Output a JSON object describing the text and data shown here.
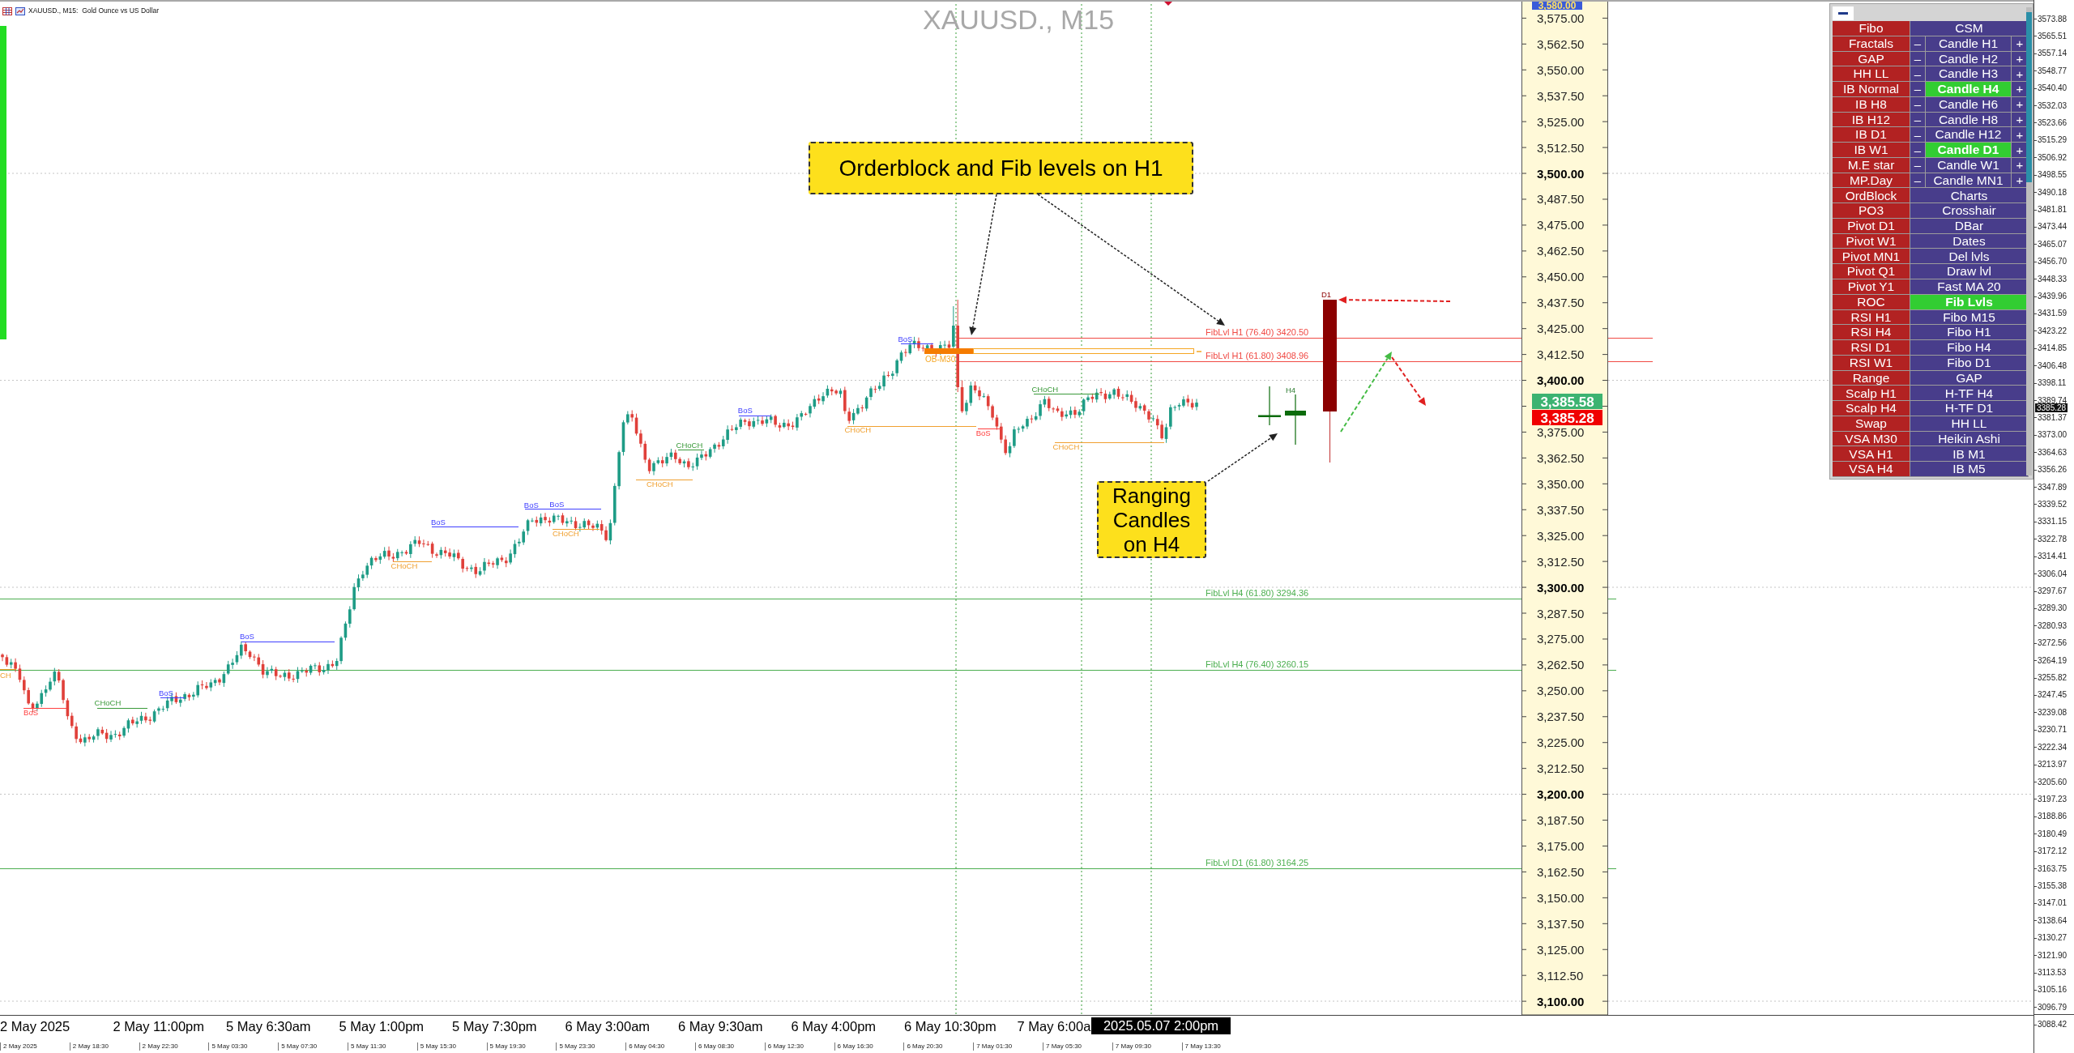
{
  "header": {
    "title": "XAUUSD., M15:  Gold Ounce vs US Dollar"
  },
  "chart": {
    "symbol_label": "XAUUSD., M15",
    "callouts": [
      {
        "text": "Orderblock and Fib levels on H1"
      },
      {
        "text": "Ranging Candles on H4"
      }
    ],
    "orderblock": {
      "label": "OB-M30"
    },
    "fib_levels": [
      {
        "label": "FibLvl H1 (76.40) 3420.50",
        "color": "#f04a44"
      },
      {
        "label": "FibLvl H1 (61.80) 3408.96",
        "color": "#f04a44"
      },
      {
        "label": "FibLvl H4 (61.80) 3294.36",
        "color": "#4caf50"
      },
      {
        "label": "FibLvl H4 (76.40) 3260.15",
        "color": "#4caf50"
      },
      {
        "label": "FibLvl D1 (61.80) 3164.25",
        "color": "#4caf50"
      }
    ],
    "structure_marks": [
      {
        "label": "CH",
        "color": "#f0a030"
      },
      {
        "label": "BoS",
        "color": "#ff4040"
      },
      {
        "label": "CHoCH",
        "color": "#3a9a3a"
      },
      {
        "label": "BoS",
        "color": "#4040ff"
      },
      {
        "label": "BoS",
        "color": "#4040ff"
      },
      {
        "label": "CHoCH",
        "color": "#f0a030"
      },
      {
        "label": "BoS",
        "color": "#4040ff"
      },
      {
        "label": "BoS",
        "color": "#4040ff"
      },
      {
        "label": "BoS",
        "color": "#4040ff"
      },
      {
        "label": "CHoCH",
        "color": "#f0a030"
      },
      {
        "label": "CHoCH",
        "color": "#f0a030"
      },
      {
        "label": "CHoCH",
        "color": "#3a9a3a"
      },
      {
        "label": "BoS",
        "color": "#4040ff"
      },
      {
        "label": "CHoCH",
        "color": "#f0a030"
      },
      {
        "label": "BoS",
        "color": "#4040ff"
      },
      {
        "label": "BoS",
        "color": "#ff4040"
      },
      {
        "label": "CHoCH",
        "color": "#3a9a3a"
      },
      {
        "label": "CHoCH",
        "color": "#f0a030"
      }
    ],
    "higher_timeframe": {
      "h4_label": "H4",
      "d1_label": "D1"
    }
  },
  "price_scale": {
    "labels": [
      {
        "text": "3,575.00",
        "major": false
      },
      {
        "text": "3,562.50",
        "major": false
      },
      {
        "text": "3,550.00",
        "major": false
      },
      {
        "text": "3,537.50",
        "major": false
      },
      {
        "text": "3,525.00",
        "major": false
      },
      {
        "text": "3,512.50",
        "major": false
      },
      {
        "text": "3,500.00",
        "major": true
      },
      {
        "text": "3,487.50",
        "major": false
      },
      {
        "text": "3,475.00",
        "major": false
      },
      {
        "text": "3,462.50",
        "major": false
      },
      {
        "text": "3,450.00",
        "major": false
      },
      {
        "text": "3,437.50",
        "major": false
      },
      {
        "text": "3,425.00",
        "major": false
      },
      {
        "text": "3,412.50",
        "major": false
      },
      {
        "text": "3,400.00",
        "major": true
      },
      {
        "text": "3,375.00",
        "major": false
      },
      {
        "text": "3,362.50",
        "major": false
      },
      {
        "text": "3,350.00",
        "major": false
      },
      {
        "text": "3,337.50",
        "major": false
      },
      {
        "text": "3,325.00",
        "major": false
      },
      {
        "text": "3,312.50",
        "major": false
      },
      {
        "text": "3,300.00",
        "major": true
      },
      {
        "text": "3,287.50",
        "major": false
      },
      {
        "text": "3,275.00",
        "major": false
      },
      {
        "text": "3,262.50",
        "major": false
      },
      {
        "text": "3,250.00",
        "major": false
      },
      {
        "text": "3,237.50",
        "major": false
      },
      {
        "text": "3,225.00",
        "major": false
      },
      {
        "text": "3,212.50",
        "major": false
      },
      {
        "text": "3,200.00",
        "major": true
      },
      {
        "text": "3,187.50",
        "major": false
      },
      {
        "text": "3,175.00",
        "major": false
      },
      {
        "text": "3,162.50",
        "major": false
      },
      {
        "text": "3,150.00",
        "major": false
      },
      {
        "text": "3,137.50",
        "major": false
      },
      {
        "text": "3,125.00",
        "major": false
      },
      {
        "text": "3,112.50",
        "major": false
      },
      {
        "text": "3,100.00",
        "major": true
      }
    ],
    "tags": [
      {
        "kind": "high",
        "text": "3,580.00"
      },
      {
        "kind": "ask",
        "text": "3,385.58"
      },
      {
        "kind": "bid",
        "text": "3,385.28"
      }
    ]
  },
  "panel": {
    "rows": [
      {
        "left": {
          "label": "Fibo",
          "selected": false
        },
        "right": {
          "label": "CSM",
          "selected": false
        }
      },
      {
        "left": {
          "label": "Fractals",
          "selected": false
        },
        "right": {
          "label": "Candle H1",
          "selected": false,
          "minus": "–",
          "plus": "+"
        }
      },
      {
        "left": {
          "label": "GAP",
          "selected": false
        },
        "right": {
          "label": "Candle H2",
          "selected": false,
          "minus": "–",
          "plus": "+"
        }
      },
      {
        "left": {
          "label": "HH LL",
          "selected": false
        },
        "right": {
          "label": "Candle H3",
          "selected": false,
          "minus": "–",
          "plus": "+"
        }
      },
      {
        "left": {
          "label": "IB Normal",
          "selected": false
        },
        "right": {
          "label": "Candle H4",
          "selected": true,
          "minus": "–",
          "plus": "+"
        }
      },
      {
        "left": {
          "label": "IB H8",
          "selected": false
        },
        "right": {
          "label": "Candle H6",
          "selected": false,
          "minus": "–",
          "plus": "+"
        }
      },
      {
        "left": {
          "label": "IB H12",
          "selected": false
        },
        "right": {
          "label": "Candle H8",
          "selected": false,
          "minus": "–",
          "plus": "+"
        }
      },
      {
        "left": {
          "label": "IB D1",
          "selected": false
        },
        "right": {
          "label": "Candle H12",
          "selected": false,
          "minus": "–",
          "plus": "+"
        }
      },
      {
        "left": {
          "label": "IB W1",
          "selected": false
        },
        "right": {
          "label": "Candle D1",
          "selected": true,
          "minus": "–",
          "plus": "+"
        }
      },
      {
        "left": {
          "label": "M.E star",
          "selected": false
        },
        "right": {
          "label": "Candle W1",
          "selected": false,
          "minus": "–",
          "plus": "+"
        }
      },
      {
        "left": {
          "label": "MP.Day",
          "selected": false
        },
        "right": {
          "label": "Candle MN1",
          "selected": false,
          "minus": "–",
          "plus": "+"
        }
      },
      {
        "left": {
          "label": "OrdBlock",
          "selected": false
        },
        "right": {
          "label": "Charts",
          "selected": false
        }
      },
      {
        "left": {
          "label": "PO3",
          "selected": false
        },
        "right": {
          "label": "Crosshair",
          "selected": false
        }
      },
      {
        "left": {
          "label": "Pivot D1",
          "selected": false
        },
        "right": {
          "label": "DBar",
          "selected": false
        }
      },
      {
        "left": {
          "label": "Pivot W1",
          "selected": false
        },
        "right": {
          "label": "Dates",
          "selected": false
        }
      },
      {
        "left": {
          "label": "Pivot MN1",
          "selected": false
        },
        "right": {
          "label": "Del lvls",
          "selected": false
        }
      },
      {
        "left": {
          "label": "Pivot Q1",
          "selected": false
        },
        "right": {
          "label": "Draw lvl",
          "selected": false
        }
      },
      {
        "left": {
          "label": "Pivot Y1",
          "selected": false
        },
        "right": {
          "label": "Fast MA 20",
          "selected": false
        }
      },
      {
        "left": {
          "label": "ROC",
          "selected": false
        },
        "right": {
          "label": "Fib Lvls",
          "selected": true
        }
      },
      {
        "left": {
          "label": "RSI H1",
          "selected": false
        },
        "right": {
          "label": "Fibo M15",
          "selected": false
        }
      },
      {
        "left": {
          "label": "RSI H4",
          "selected": false
        },
        "right": {
          "label": "Fibo H1",
          "selected": false
        }
      },
      {
        "left": {
          "label": "RSI D1",
          "selected": false
        },
        "right": {
          "label": "Fibo H4",
          "selected": false
        }
      },
      {
        "left": {
          "label": "RSI W1",
          "selected": false
        },
        "right": {
          "label": "Fibo D1",
          "selected": false
        }
      },
      {
        "left": {
          "label": "Range",
          "selected": false
        },
        "right": {
          "label": "GAP",
          "selected": false
        }
      },
      {
        "left": {
          "label": "Scalp H1",
          "selected": false
        },
        "right": {
          "label": "H-TF H4",
          "selected": false
        }
      },
      {
        "left": {
          "label": "Scalp H4",
          "selected": false
        },
        "right": {
          "label": "H-TF D1",
          "selected": false
        }
      },
      {
        "left": {
          "label": "Swap",
          "selected": false
        },
        "right": {
          "label": "HH LL",
          "selected": false
        }
      },
      {
        "left": {
          "label": "VSA M30",
          "selected": false
        },
        "right": {
          "label": "Heikin Ashi",
          "selected": false
        }
      },
      {
        "left": {
          "label": "VSA H1",
          "selected": false
        },
        "right": {
          "label": "IB M1",
          "selected": false
        }
      },
      {
        "left": {
          "label": "VSA H4",
          "selected": false
        },
        "right": {
          "label": "IB M5",
          "selected": false
        }
      }
    ]
  },
  "price_axis": {
    "labels": [
      "3573.88",
      "3565.51",
      "3557.14",
      "3548.77",
      "3540.40",
      "3532.03",
      "3523.66",
      "3515.29",
      "3506.92",
      "3498.55",
      "3490.18",
      "3481.81",
      "3473.44",
      "3465.07",
      "3456.70",
      "3448.33",
      "3439.96",
      "3431.59",
      "3423.22",
      "3414.85",
      "3406.48",
      "3398.11",
      "3389.74",
      "3381.37",
      "3373.00",
      "3364.63",
      "3356.26",
      "3347.89",
      "3339.52",
      "3331.15",
      "3322.78",
      "3314.41",
      "3306.04",
      "3297.67",
      "3289.30",
      "3280.93",
      "3272.56",
      "3264.19",
      "3255.82",
      "3247.45",
      "3239.08",
      "3230.71",
      "3222.34",
      "3213.97",
      "3205.60",
      "3197.23",
      "3188.86",
      "3180.49",
      "3172.12",
      "3163.75",
      "3155.38",
      "3147.01",
      "3138.64",
      "3130.27",
      "3121.90",
      "3113.53",
      "3105.16",
      "3096.79",
      "3088.42"
    ],
    "current": "3385.28"
  },
  "time_axis": {
    "labels": [
      "2 May 2025",
      "2 May 11:00pm",
      "5 May 6:30am",
      "5 May 1:00pm",
      "5 May 7:30pm",
      "6 May 3:00am",
      "6 May 9:30am",
      "6 May 4:00pm",
      "6 May 10:30pm",
      "7 May 6:00a"
    ],
    "cursor": "2025.05.07 2:00pm",
    "minor_labels": [
      "2 May 2025",
      "2 May 18:30",
      "2 May 22:30",
      "5 May 03:30",
      "5 May 07:30",
      "5 May 11:30",
      "5 May 15:30",
      "5 May 19:30",
      "5 May 23:30",
      "6 May 04:30",
      "6 May 08:30",
      "6 May 12:30",
      "6 May 16:30",
      "6 May 20:30",
      "7 May 01:30",
      "7 May 05:30",
      "7 May 09:30",
      "7 May 13:30"
    ]
  }
}
